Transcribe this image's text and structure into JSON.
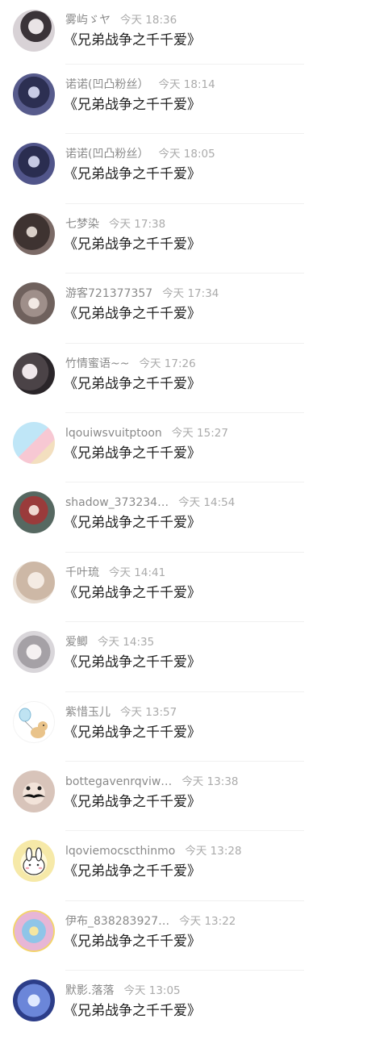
{
  "comments": [
    {
      "name": "雾屿ゞヤ",
      "time": "今天 18:36",
      "text": "《兄弟战争之千千爱》"
    },
    {
      "name": "诺诺(凹凸粉丝）",
      "time": "今天 18:14",
      "text": "《兄弟战争之千千爱》"
    },
    {
      "name": "诺诺(凹凸粉丝）",
      "time": "今天 18:05",
      "text": "《兄弟战争之千千爱》"
    },
    {
      "name": "七梦染",
      "time": "今天 17:38",
      "text": "《兄弟战争之千千爱》"
    },
    {
      "name": "游客721377357",
      "time": "今天 17:34",
      "text": "《兄弟战争之千千爱》"
    },
    {
      "name": "竹情蜜语~~",
      "time": "今天 17:26",
      "text": "《兄弟战争之千千爱》"
    },
    {
      "name": "lqouiwsvuitptoon",
      "time": "今天 15:27",
      "text": "《兄弟战争之千千爱》"
    },
    {
      "name": "shadow_373234…",
      "time": "今天 14:54",
      "text": "《兄弟战争之千千爱》"
    },
    {
      "name": "千叶琉",
      "time": "今天 14:41",
      "text": "《兄弟战争之千千爱》"
    },
    {
      "name": "爱鲫",
      "time": "今天 14:35",
      "text": "《兄弟战争之千千爱》"
    },
    {
      "name": "紫惜玉儿",
      "time": "今天 13:57",
      "text": "《兄弟战争之千千爱》"
    },
    {
      "name": "bottegavenrqviw…",
      "time": "今天 13:38",
      "text": "《兄弟战争之千千爱》"
    },
    {
      "name": "lqoviemocscthinmo",
      "time": "今天 13:28",
      "text": "《兄弟战争之千千爱》"
    },
    {
      "name": "伊布_838283927…",
      "time": "今天 13:22",
      "text": "《兄弟战争之千千爱》"
    },
    {
      "name": "默影.落落",
      "time": "今天 13:05",
      "text": "《兄弟战争之千千爱》"
    }
  ]
}
